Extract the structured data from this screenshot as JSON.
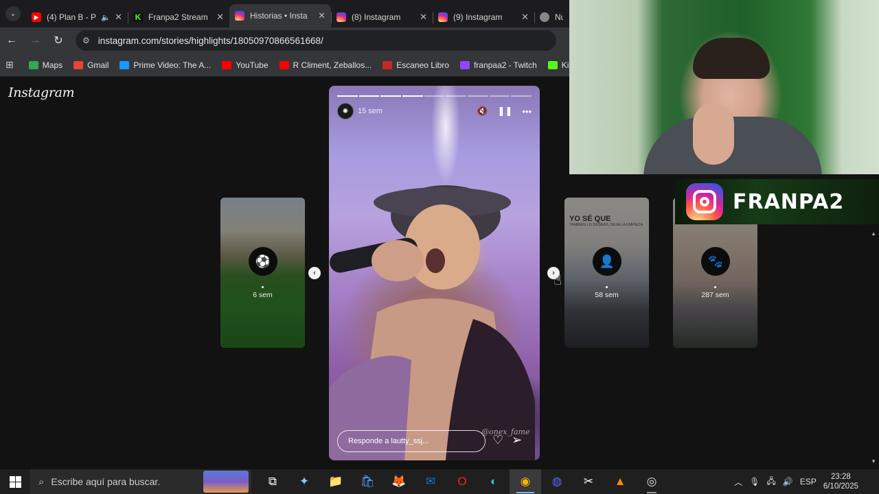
{
  "browser": {
    "tabs": [
      {
        "title": "(4) Plan B - P",
        "icon": "youtube-icon",
        "favicon_class": "fav-yt",
        "glyph": "▶",
        "muted_icon": "speaker-icon",
        "active": false
      },
      {
        "title": "Franpa2 Stream",
        "icon": "kick-icon",
        "favicon_class": "fav-kick",
        "glyph": "K",
        "active": false
      },
      {
        "title": "Historias • Insta",
        "icon": "instagram-icon",
        "favicon_class": "fav-ig",
        "glyph": "",
        "active": true
      },
      {
        "title": "(8) Instagram",
        "icon": "instagram-icon",
        "favicon_class": "fav-ig",
        "glyph": "",
        "active": false
      },
      {
        "title": "(9) Instagram",
        "icon": "instagram-icon",
        "favicon_class": "fav-ig",
        "glyph": "",
        "active": false
      },
      {
        "title": "Nue",
        "icon": "globe-icon",
        "favicon_class": "fav-globe",
        "glyph": "",
        "active": false
      }
    ],
    "url": "instagram.com/stories/highlights/18050970866561668/",
    "bookmarks": [
      {
        "label": "Maps",
        "icon": "maps-icon",
        "color": "#34a853"
      },
      {
        "label": "Gmail",
        "icon": "gmail-icon",
        "color": "#ea4335"
      },
      {
        "label": "Prime Video: The A...",
        "icon": "prime-video-icon",
        "color": "#1a98ff"
      },
      {
        "label": "YouTube",
        "icon": "youtube-icon",
        "color": "#ff0000"
      },
      {
        "label": "R Climent, Zeballos...",
        "icon": "youtube-icon",
        "color": "#ff0000"
      },
      {
        "label": "Escaneo Libro",
        "icon": "book-icon",
        "color": "#c62828"
      },
      {
        "label": "franpaa2 - Twitch",
        "icon": "twitch-icon",
        "color": "#9146ff"
      },
      {
        "label": "Kick",
        "icon": "kick-icon",
        "color": "#53fc18"
      }
    ]
  },
  "instagram": {
    "logo": "Instagram",
    "main_story": {
      "age": "15 sem",
      "reply_placeholder": "Responde a lautty_ssj...",
      "watermark": "@onex_fame",
      "progress_total": 9,
      "progress_done": 4
    },
    "side_stories": [
      {
        "age": "6 sem",
        "icon": "soccer-ball-icon",
        "glyph": "⚽"
      },
      {
        "age": "58 sem",
        "icon": "person-icon",
        "glyph": "👤",
        "text": "YO SÉ QUE",
        "subtext": "TAMBIÉN LO DESEAS, DEJA LA EMPIEZA"
      },
      {
        "age": "287 sem",
        "icon": "paw-icon",
        "glyph": "🐾"
      }
    ]
  },
  "overlay": {
    "channel_name": "FRANPA2"
  },
  "taskbar": {
    "search_placeholder": "Escribe aquí para buscar.",
    "apps": [
      {
        "name": "task-view-icon",
        "glyph": "⧉",
        "color": "#ffffff",
        "state": ""
      },
      {
        "name": "copilot-icon",
        "glyph": "✦",
        "color": "#8ec5ff",
        "state": ""
      },
      {
        "name": "file-explorer-icon",
        "glyph": "📁",
        "color": "#f5c542",
        "state": ""
      },
      {
        "name": "microsoft-store-icon",
        "glyph": "🛍",
        "color": "#4fa3ff",
        "state": ""
      },
      {
        "name": "firefox-icon",
        "glyph": "🦊",
        "color": "#ff7139",
        "state": ""
      },
      {
        "name": "outlook-icon",
        "glyph": "✉",
        "color": "#0f78d4",
        "state": ""
      },
      {
        "name": "opera-icon",
        "glyph": "O",
        "color": "#ff1b2d",
        "state": ""
      },
      {
        "name": "edge-icon",
        "glyph": "◐",
        "color": "#2ec4b6",
        "state": ""
      },
      {
        "name": "chrome-icon",
        "glyph": "◉",
        "color": "#f4b400",
        "state": "active"
      },
      {
        "name": "discord-icon",
        "glyph": "◍",
        "color": "#5865f2",
        "state": ""
      },
      {
        "name": "capcut-icon",
        "glyph": "✂",
        "color": "#ffffff",
        "state": ""
      },
      {
        "name": "vlc-icon",
        "glyph": "▲",
        "color": "#ff8800",
        "state": ""
      },
      {
        "name": "obs-icon",
        "glyph": "◎",
        "color": "#dddddd",
        "state": "running"
      }
    ],
    "language": "ESP",
    "time": "23:28",
    "date": "6/10/2025"
  }
}
